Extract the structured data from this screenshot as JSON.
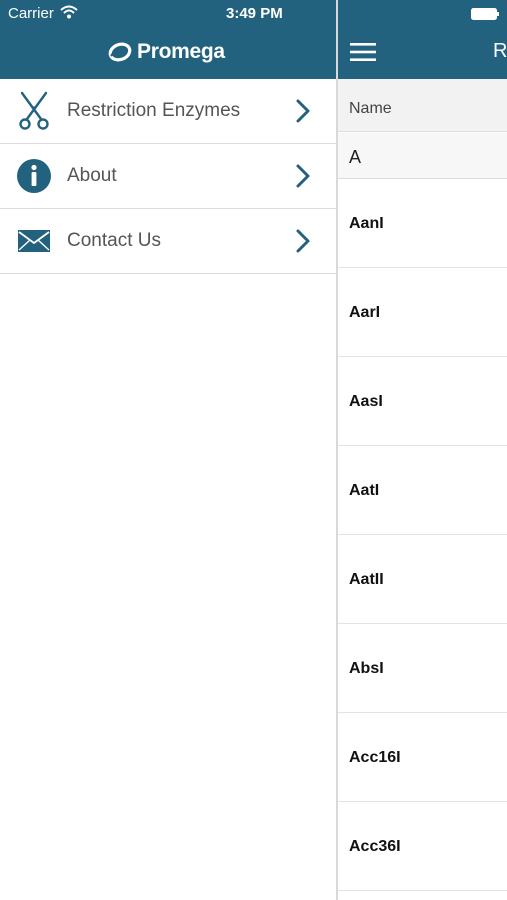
{
  "status_bar": {
    "carrier": "Carrier",
    "time": "3:49 PM"
  },
  "brand": {
    "logo_text": "Promega",
    "header_color": "#23627f"
  },
  "menu": {
    "items": [
      {
        "label": "Restriction Enzymes",
        "icon": "scissors-icon"
      },
      {
        "label": "About",
        "icon": "info-icon"
      },
      {
        "label": "Contact Us",
        "icon": "envelope-icon"
      }
    ]
  },
  "content": {
    "title": "R",
    "column_header": "Name",
    "section": "A",
    "enzymes": [
      "AanI",
      "AarI",
      "AasI",
      "AatI",
      "AatII",
      "AbsI",
      "Acc16I",
      "Acc36I"
    ]
  }
}
